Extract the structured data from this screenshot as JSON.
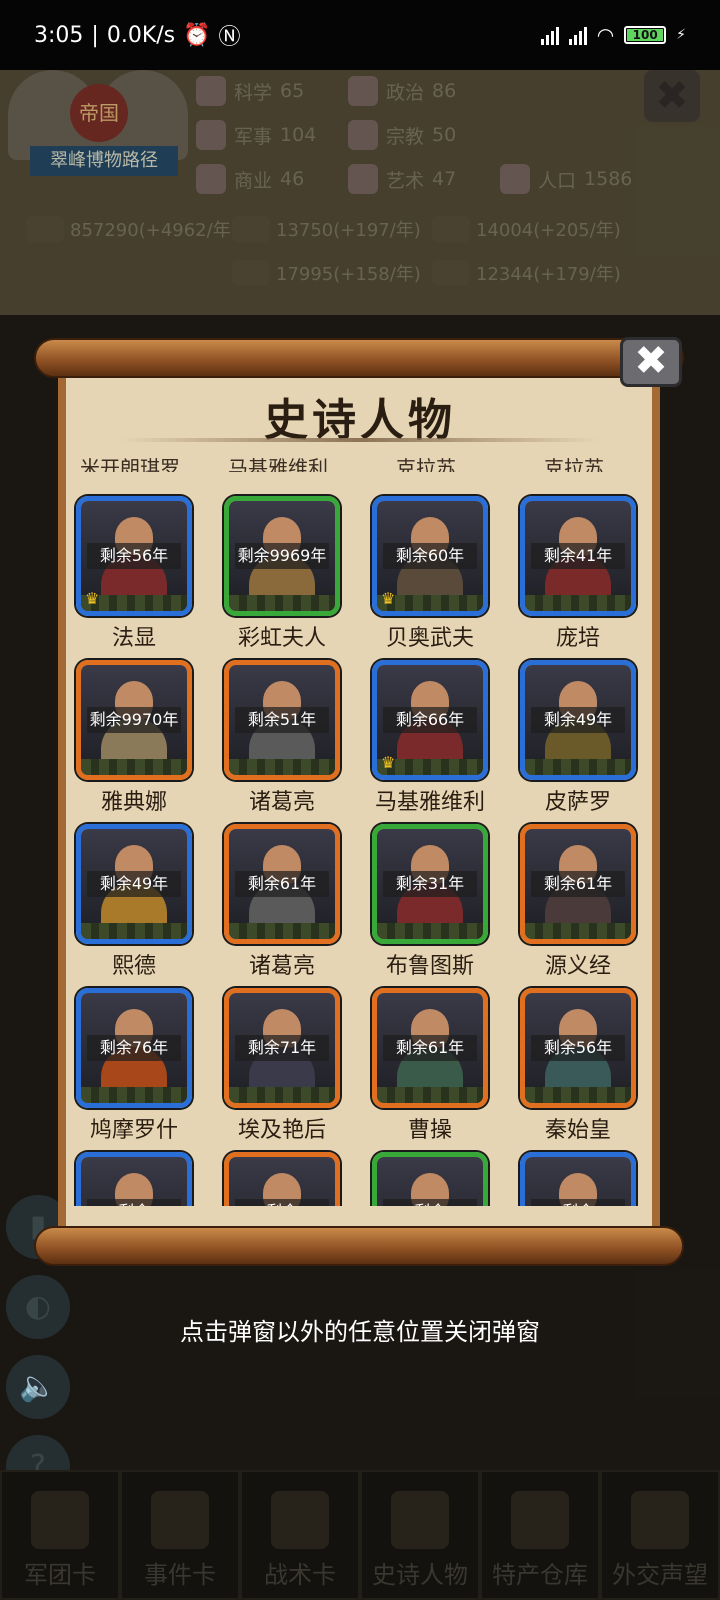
{
  "status_bar": {
    "time": "3:05",
    "speed": "0.0K/s",
    "battery": "100"
  },
  "background": {
    "emblem_top": "帝国",
    "emblem_name": "翠峰博物路径",
    "stats": [
      {
        "label": "科学",
        "value": "65"
      },
      {
        "label": "政治",
        "value": "86"
      },
      {
        "label": "军事",
        "value": "104"
      },
      {
        "label": "宗教",
        "value": "50"
      },
      {
        "label": "商业",
        "value": "46"
      },
      {
        "label": "艺术",
        "value": "47"
      },
      {
        "label": "人口",
        "value": "1586"
      }
    ],
    "resources": [
      "857290(+4962/年)",
      "13750(+197/年)",
      "14004(+205/年)",
      "17995(+158/年)",
      "12344(+179/年)"
    ],
    "bottom_tabs": [
      "军团卡",
      "事件卡",
      "战术卡",
      "史诗人物",
      "特产仓库",
      "外交声望"
    ]
  },
  "modal": {
    "title": "史诗人物",
    "close_symbol": "✖",
    "partial_top_names": [
      "米开朗琪罗",
      "马基雅维利",
      "克拉苏",
      "克拉苏"
    ],
    "characters": [
      {
        "name": "法显",
        "remaining": "剩余56年",
        "frame": "blue",
        "crown": true,
        "color": "#7a2a2a"
      },
      {
        "name": "彩虹夫人",
        "remaining": "剩余9969年",
        "frame": "green",
        "crown": false,
        "color": "#8a6a3a"
      },
      {
        "name": "贝奥武夫",
        "remaining": "剩余60年",
        "frame": "blue",
        "crown": true,
        "color": "#5a4a3a"
      },
      {
        "name": "庞培",
        "remaining": "剩余41年",
        "frame": "blue",
        "crown": false,
        "color": "#7a2a28"
      },
      {
        "name": "雅典娜",
        "remaining": "剩余9970年",
        "frame": "orange",
        "crown": false,
        "color": "#8a7a5a"
      },
      {
        "name": "诸葛亮",
        "remaining": "剩余51年",
        "frame": "orange",
        "crown": false,
        "color": "#5a5a5a"
      },
      {
        "name": "马基雅维利",
        "remaining": "剩余66年",
        "frame": "blue",
        "crown": true,
        "color": "#7a2a2a"
      },
      {
        "name": "皮萨罗",
        "remaining": "剩余49年",
        "frame": "blue",
        "crown": false,
        "color": "#6a5a2a"
      },
      {
        "name": "熙德",
        "remaining": "剩余49年",
        "frame": "blue",
        "crown": false,
        "color": "#a87a2a"
      },
      {
        "name": "诸葛亮",
        "remaining": "剩余61年",
        "frame": "orange",
        "crown": false,
        "color": "#5a5a5a"
      },
      {
        "name": "布鲁图斯",
        "remaining": "剩余31年",
        "frame": "green",
        "crown": false,
        "color": "#7a2a2a"
      },
      {
        "name": "源义经",
        "remaining": "剩余61年",
        "frame": "orange",
        "crown": false,
        "color": "#4a3a3a"
      },
      {
        "name": "鸠摩罗什",
        "remaining": "剩余76年",
        "frame": "blue",
        "crown": false,
        "color": "#a8481a"
      },
      {
        "name": "埃及艳后",
        "remaining": "剩余71年",
        "frame": "orange",
        "crown": false,
        "color": "#3a3a4a"
      },
      {
        "name": "曹操",
        "remaining": "剩余61年",
        "frame": "orange",
        "crown": false,
        "color": "#3a5a4a"
      },
      {
        "name": "秦始皇",
        "remaining": "剩余56年",
        "frame": "orange",
        "crown": false,
        "color": "#3a5a5a"
      },
      {
        "name": "",
        "remaining": "剩余",
        "frame": "blue",
        "crown": false,
        "color": "#5a3a2a"
      },
      {
        "name": "",
        "remaining": "剩余",
        "frame": "orange",
        "crown": false,
        "color": "#4a3a2a"
      },
      {
        "name": "",
        "remaining": "剩余",
        "frame": "green",
        "crown": false,
        "color": "#4a4a3a"
      },
      {
        "name": "",
        "remaining": "剩余",
        "frame": "blue",
        "crown": false,
        "color": "#5a5a6a"
      }
    ]
  },
  "hint": "点击弹窗以外的任意位置关闭弹窗"
}
